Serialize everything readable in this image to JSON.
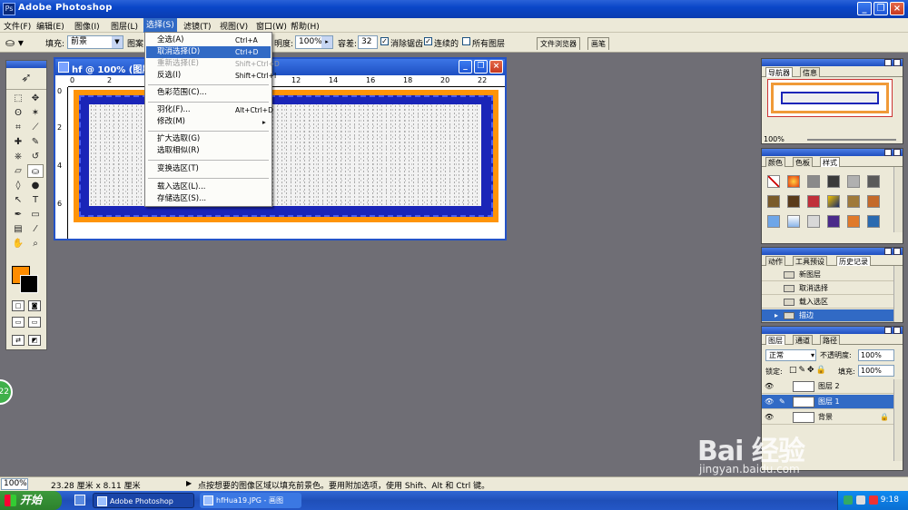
{
  "app": {
    "title": "Adobe Photoshop"
  },
  "menu": [
    "文件(F)",
    "编辑(E)",
    "图像(I)",
    "图层(L)",
    "选择(S)",
    "滤镜(T)",
    "视图(V)",
    "窗口(W)",
    "帮助(H)"
  ],
  "options": {
    "fill_label": "填充:",
    "fill_value": "前景",
    "pattern_label": "图案",
    "opacity_label": "明度:",
    "opacity_value": "100%",
    "tolerance_label": "容差:",
    "tolerance_value": "32",
    "antialias_label": "消除锯齿",
    "contiguous_label": "连续的",
    "all_layers_label": "所有图层",
    "tab_file_browser": "文件浏览器",
    "tab_brushes": "画笔"
  },
  "document": {
    "title": "hf @ 100% (图层",
    "ruler_h": [
      "0",
      "2",
      "4",
      "6",
      "8",
      "10",
      "12",
      "14",
      "16",
      "18",
      "20",
      "22"
    ],
    "ruler_v": [
      "0",
      "2",
      "4",
      "6"
    ],
    "canvas_colors": {
      "border": "#ff9408",
      "frame": "#1a25b8"
    }
  },
  "select_menu": {
    "items": [
      {
        "label": "全选(A)",
        "shortcut": "Ctrl+A",
        "state": "normal"
      },
      {
        "label": "取消选择(D)",
        "shortcut": "Ctrl+D",
        "state": "highlight"
      },
      {
        "label": "重新选择(E)",
        "shortcut": "Shift+Ctrl+D",
        "state": "disabled"
      },
      {
        "label": "反选(I)",
        "shortcut": "Shift+Ctrl+I",
        "state": "normal"
      },
      {
        "label": "色彩范围(C)...",
        "shortcut": "",
        "state": "normal"
      },
      {
        "label": "羽化(F)...",
        "shortcut": "Alt+Ctrl+D",
        "state": "normal"
      },
      {
        "label": "修改(M)",
        "shortcut": "▸",
        "state": "normal"
      },
      {
        "label": "扩大选取(G)",
        "shortcut": "",
        "state": "normal"
      },
      {
        "label": "选取相似(R)",
        "shortcut": "",
        "state": "normal"
      },
      {
        "label": "变换选区(T)",
        "shortcut": "",
        "state": "normal"
      },
      {
        "label": "载入选区(L)...",
        "shortcut": "",
        "state": "normal"
      },
      {
        "label": "存储选区(S)...",
        "shortcut": "",
        "state": "normal"
      }
    ]
  },
  "navigator": {
    "tabs": [
      "导航器",
      "信息"
    ],
    "zoom": "100%"
  },
  "styles_panel": {
    "tabs": [
      "颜色",
      "色板",
      "样式"
    ]
  },
  "history_panel": {
    "tabs": [
      "动作",
      "工具预设",
      "历史记录"
    ],
    "items": [
      "新图层",
      "取消选择",
      "载入选区",
      "描边"
    ],
    "selected_index": 3
  },
  "layers_panel": {
    "tabs": [
      "图层",
      "通道",
      "路径"
    ],
    "blend_mode": "正常",
    "opacity_label": "不透明度:",
    "opacity_value": "100%",
    "lock_label": "锁定:",
    "fill_label": "填充:",
    "fill_value": "100%",
    "layers": [
      {
        "name": "图层 2",
        "selected": false
      },
      {
        "name": "图层 1",
        "selected": true
      },
      {
        "name": "背景",
        "selected": false
      }
    ]
  },
  "status": {
    "zoom": "100%",
    "doc_size": "23.28 厘米 x 8.11 厘米",
    "hint": "点按想要的图像区域以填充前景色。要用附加选项，使用 Shift、Alt 和 Ctrl 键。"
  },
  "taskbar": {
    "start_label": "开始",
    "buttons": [
      "Adobe Photoshop",
      "hfHua19.JPG - 画图"
    ],
    "clock": "9:18"
  },
  "watermark": {
    "brand": "Bai 经验",
    "url": "jingyan.baidu.com"
  },
  "side_badge": "22"
}
